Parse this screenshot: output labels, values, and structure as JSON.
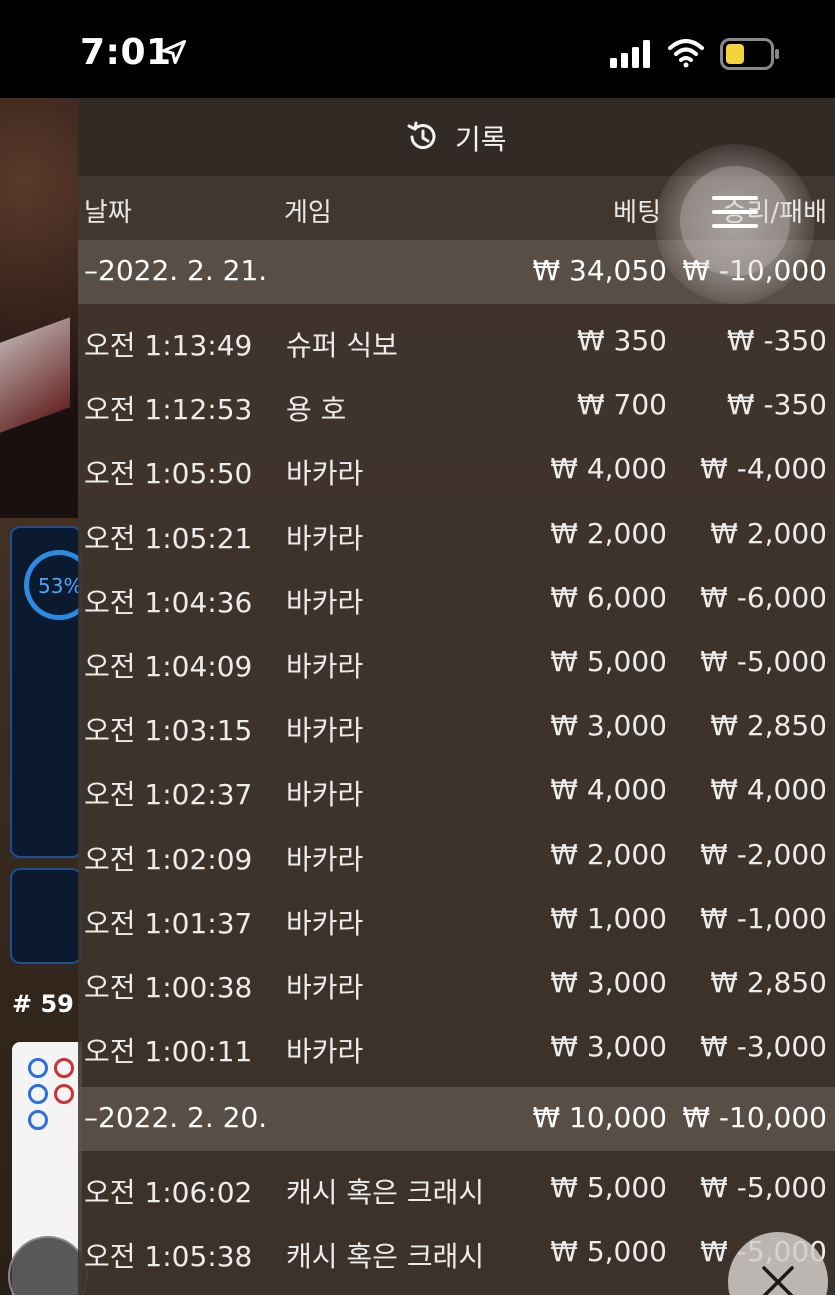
{
  "status_bar": {
    "time": "7:01"
  },
  "background": {
    "stat_percent": "53%",
    "round_label": "# 59"
  },
  "panel": {
    "title": "기록",
    "columns": {
      "date": "날짜",
      "game": "게임",
      "bet": "베팅",
      "result": "승리/패배"
    },
    "groups": [
      {
        "date": "–2022. 2. 21.",
        "bet_total": "₩ 34,050",
        "result_total": "₩ -10,000",
        "rows": [
          {
            "time": "오전 1:13:49",
            "game": "슈퍼 식보",
            "bet": "₩ 350",
            "result": "₩ -350"
          },
          {
            "time": "오전 1:12:53",
            "game": "용 호",
            "bet": "₩ 700",
            "result": "₩ -350"
          },
          {
            "time": "오전 1:05:50",
            "game": "바카라",
            "bet": "₩ 4,000",
            "result": "₩ -4,000"
          },
          {
            "time": "오전 1:05:21",
            "game": "바카라",
            "bet": "₩ 2,000",
            "result": "₩ 2,000"
          },
          {
            "time": "오전 1:04:36",
            "game": "바카라",
            "bet": "₩ 6,000",
            "result": "₩ -6,000"
          },
          {
            "time": "오전 1:04:09",
            "game": "바카라",
            "bet": "₩ 5,000",
            "result": "₩ -5,000"
          },
          {
            "time": "오전 1:03:15",
            "game": "바카라",
            "bet": "₩ 3,000",
            "result": "₩ 2,850"
          },
          {
            "time": "오전 1:02:37",
            "game": "바카라",
            "bet": "₩ 4,000",
            "result": "₩ 4,000"
          },
          {
            "time": "오전 1:02:09",
            "game": "바카라",
            "bet": "₩ 2,000",
            "result": "₩ -2,000"
          },
          {
            "time": "오전 1:01:37",
            "game": "바카라",
            "bet": "₩ 1,000",
            "result": "₩ -1,000"
          },
          {
            "time": "오전 1:00:38",
            "game": "바카라",
            "bet": "₩ 3,000",
            "result": "₩ 2,850"
          },
          {
            "time": "오전 1:00:11",
            "game": "바카라",
            "bet": "₩ 3,000",
            "result": "₩ -3,000"
          }
        ]
      },
      {
        "date": "–2022. 2. 20.",
        "bet_total": "₩ 10,000",
        "result_total": "₩ -10,000",
        "rows": [
          {
            "time": "오전 1:06:02",
            "game": "캐시 혹은 크래시",
            "bet": "₩ 5,000",
            "result": "₩ -5,000"
          },
          {
            "time": "오전 1:05:38",
            "game": "캐시 혹은 크래시",
            "bet": "₩ 5,000",
            "result": "₩ -5,000"
          }
        ]
      }
    ]
  },
  "icons": {
    "location": "location-arrow-icon",
    "signal": "cellular-signal-icon",
    "wifi": "wifi-icon",
    "battery": "battery-icon",
    "history": "history-clock-icon",
    "menu": "hamburger-menu-icon",
    "close": "close-icon"
  },
  "colors": {
    "panel_bg": "#3e342c",
    "group_row_bg": "#60564e",
    "text": "#ececec",
    "battery_fill": "#f5d33b",
    "stat_accent": "#2b8be0"
  }
}
